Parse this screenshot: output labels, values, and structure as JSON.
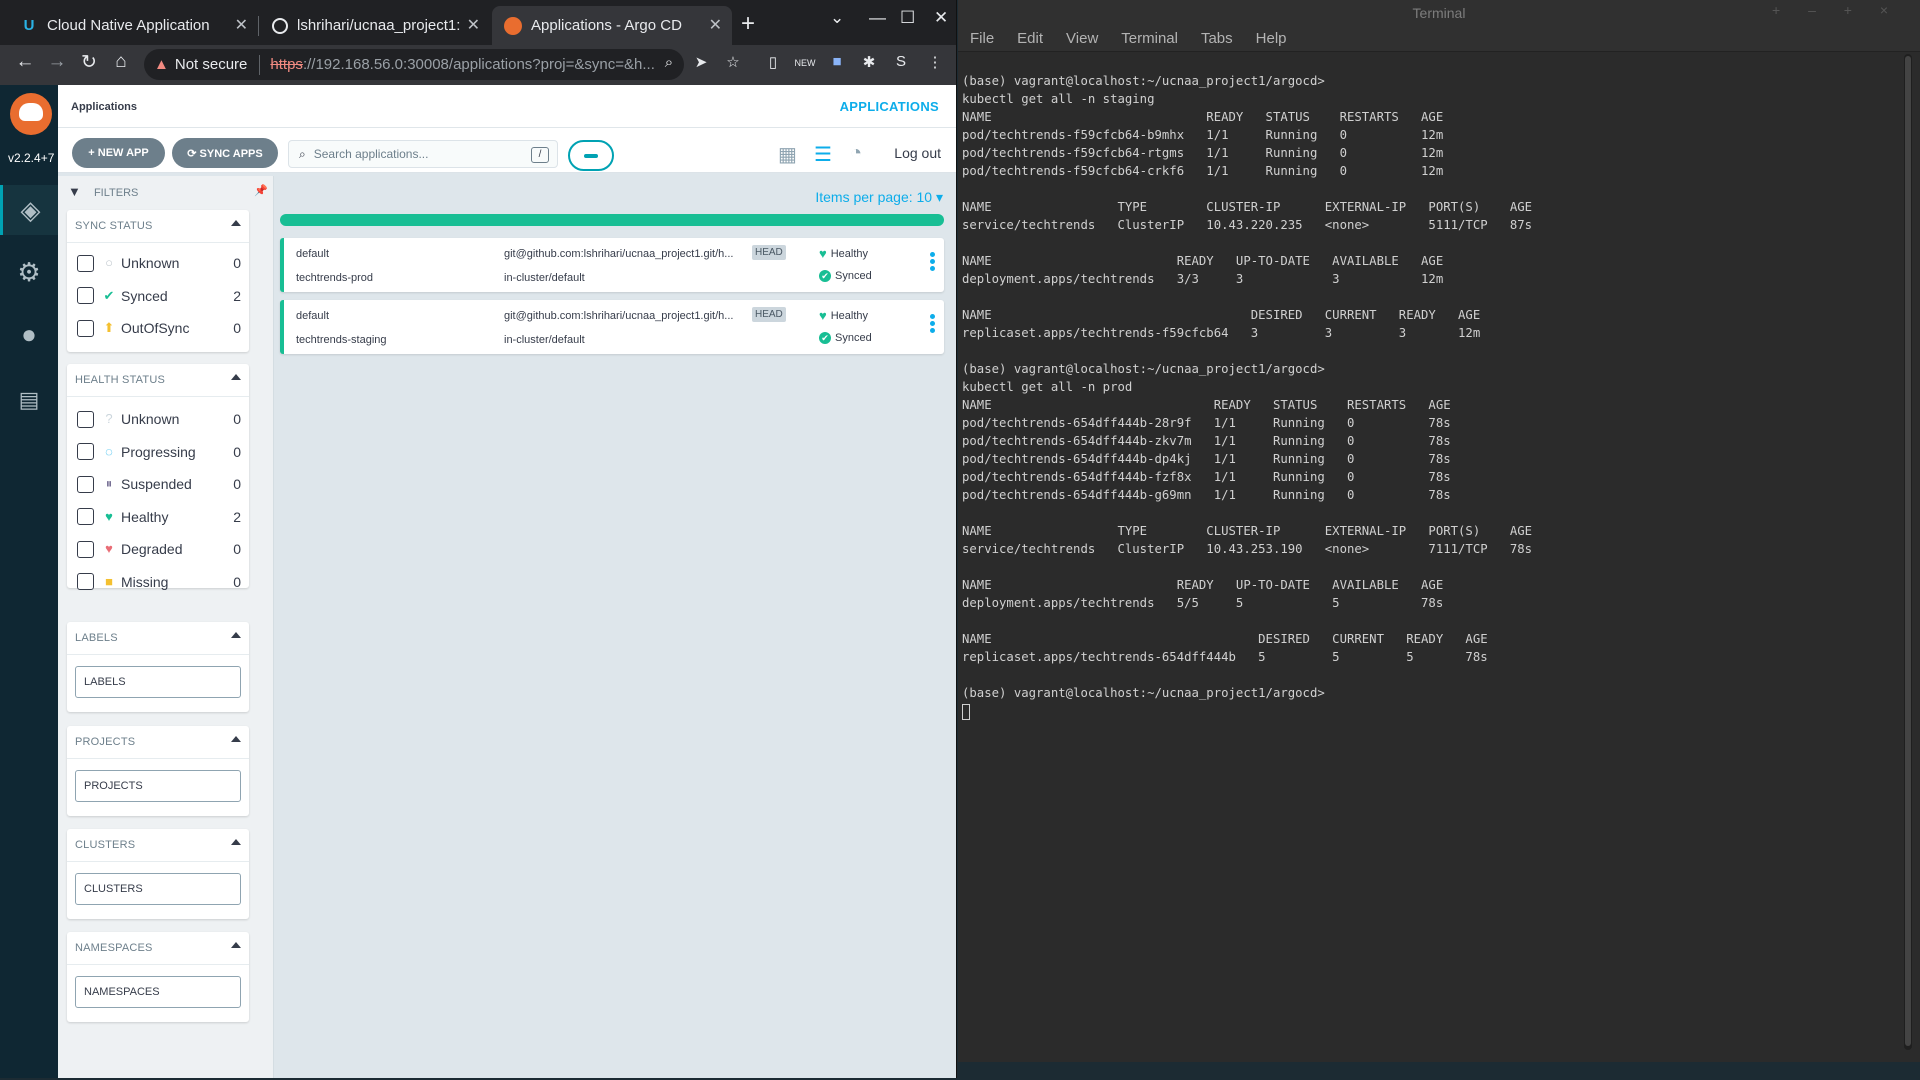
{
  "browser": {
    "tabs": [
      {
        "title": "Cloud Native Application",
        "active": false
      },
      {
        "title": "lshrihari/ucnaa_project1:",
        "active": false
      },
      {
        "title": "Applications - Argo CD",
        "active": true
      }
    ],
    "security_label": "Not secure",
    "url_scheme": "https",
    "url_rest": "://192.168.56.0:30008/applications?proj=&sync=&h...",
    "profile_initial": "S"
  },
  "argo": {
    "version": "v2.2.4+7",
    "breadcrumb": "Applications",
    "page_title": "APPLICATIONS",
    "new_app": "+ NEW APP",
    "sync_apps": "⟳ SYNC APPS",
    "search_placeholder": "Search applications...",
    "search_shortcut": "/",
    "logout": "Log out",
    "items_per_page": "Items per page: 10 ▾",
    "filters_title": "FILTERS",
    "sync_status": {
      "title": "SYNC STATUS",
      "items": [
        {
          "label": "Unknown",
          "count": "0",
          "icon": "○",
          "color": "#c0c8ce"
        },
        {
          "label": "Synced",
          "count": "2",
          "icon": "✔",
          "color": "#18be94"
        },
        {
          "label": "OutOfSync",
          "count": "0",
          "icon": "⬆",
          "color": "#f4c030"
        }
      ]
    },
    "health_status": {
      "title": "HEALTH STATUS",
      "items": [
        {
          "label": "Unknown",
          "count": "0",
          "icon": "?",
          "color": "#ccd6dd"
        },
        {
          "label": "Progressing",
          "count": "0",
          "icon": "◌",
          "color": "#0dadea"
        },
        {
          "label": "Suspended",
          "count": "0",
          "icon": "⏸",
          "color": "#766f94"
        },
        {
          "label": "Healthy",
          "count": "2",
          "icon": "♥",
          "color": "#18be94"
        },
        {
          "label": "Degraded",
          "count": "0",
          "icon": "♥",
          "color": "#e96d76"
        },
        {
          "label": "Missing",
          "count": "0",
          "icon": "■",
          "color": "#f4c030"
        }
      ]
    },
    "labels": {
      "title": "LABELS",
      "placeholder": "LABELS"
    },
    "projects": {
      "title": "PROJECTS",
      "placeholder": "PROJECTS"
    },
    "clusters": {
      "title": "CLUSTERS",
      "placeholder": "CLUSTERS"
    },
    "namespaces": {
      "title": "NAMESPACES",
      "placeholder": "NAMESPACES"
    },
    "apps": [
      {
        "project": "default",
        "name": "techtrends-prod",
        "repo": "git@github.com:lshrihari/ucnaa_project1.git/h...",
        "revision": "HEAD",
        "destination": "in-cluster/default",
        "health": "Healthy",
        "sync": "Synced"
      },
      {
        "project": "default",
        "name": "techtrends-staging",
        "repo": "git@github.com:lshrihari/ucnaa_project1.git/h...",
        "revision": "HEAD",
        "destination": "in-cluster/default",
        "health": "Healthy",
        "sync": "Synced"
      }
    ]
  },
  "terminal": {
    "title": "Terminal",
    "menu": [
      "File",
      "Edit",
      "View",
      "Terminal",
      "Tabs",
      "Help"
    ],
    "lines": [
      "(base) vagrant@localhost:~/ucnaa_project1/argocd>",
      "kubectl get all -n staging",
      "NAME                             READY   STATUS    RESTARTS   AGE",
      "pod/techtrends-f59cfcb64-b9mhx   1/1     Running   0          12m",
      "pod/techtrends-f59cfcb64-rtgms   1/1     Running   0          12m",
      "pod/techtrends-f59cfcb64-crkf6   1/1     Running   0          12m",
      "",
      "NAME                 TYPE        CLUSTER-IP      EXTERNAL-IP   PORT(S)    AGE",
      "service/techtrends   ClusterIP   10.43.220.235   <none>        5111/TCP   87s",
      "",
      "NAME                         READY   UP-TO-DATE   AVAILABLE   AGE",
      "deployment.apps/techtrends   3/3     3            3           12m",
      "",
      "NAME                                   DESIRED   CURRENT   READY   AGE",
      "replicaset.apps/techtrends-f59cfcb64   3         3         3       12m",
      "",
      "(base) vagrant@localhost:~/ucnaa_project1/argocd>",
      "kubectl get all -n prod",
      "NAME                              READY   STATUS    RESTARTS   AGE",
      "pod/techtrends-654dff444b-28r9f   1/1     Running   0          78s",
      "pod/techtrends-654dff444b-zkv7m   1/1     Running   0          78s",
      "pod/techtrends-654dff444b-dp4kj   1/1     Running   0          78s",
      "pod/techtrends-654dff444b-fzf8x   1/1     Running   0          78s",
      "pod/techtrends-654dff444b-g69mn   1/1     Running   0          78s",
      "",
      "NAME                 TYPE        CLUSTER-IP      EXTERNAL-IP   PORT(S)    AGE",
      "service/techtrends   ClusterIP   10.43.253.190   <none>        7111/TCP   78s",
      "",
      "NAME                         READY   UP-TO-DATE   AVAILABLE   AGE",
      "deployment.apps/techtrends   5/5     5            5           78s",
      "",
      "NAME                                    DESIRED   CURRENT   READY   AGE",
      "replicaset.apps/techtrends-654dff444b   5         5         5       78s",
      "",
      "(base) vagrant@localhost:~/ucnaa_project1/argocd>"
    ]
  }
}
